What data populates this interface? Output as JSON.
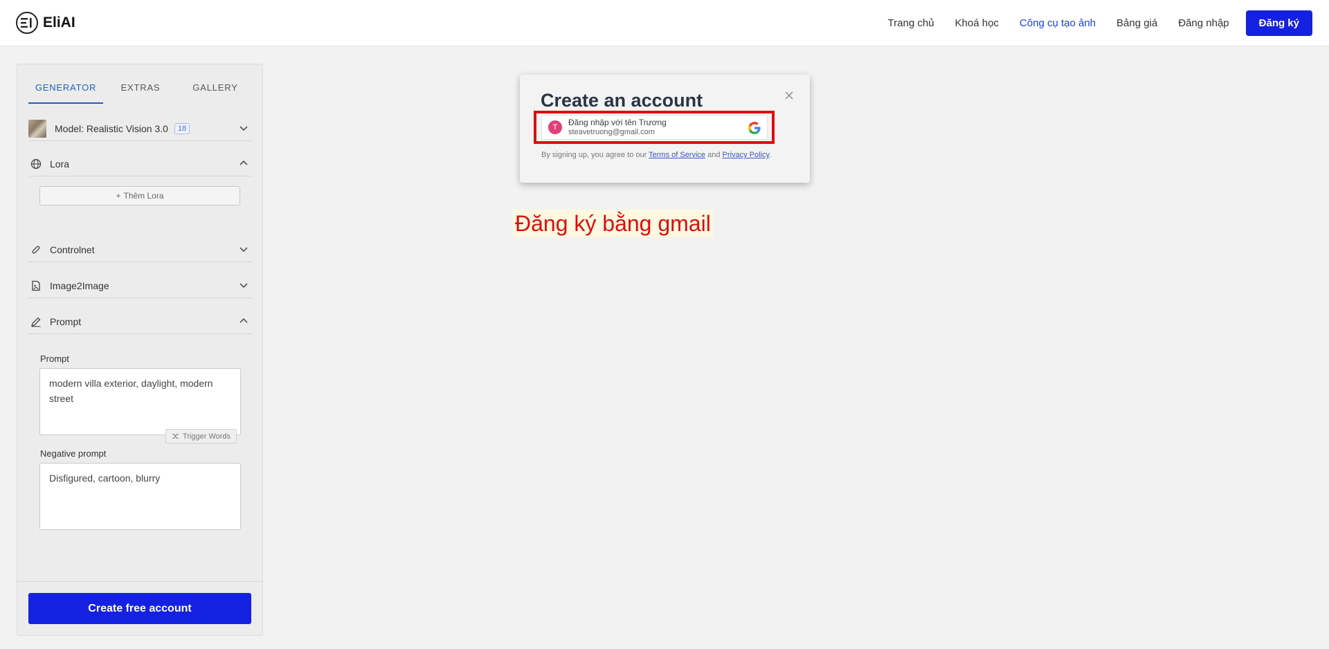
{
  "header": {
    "logo_text": "EliAI",
    "nav": [
      {
        "label": "Trang chủ"
      },
      {
        "label": "Khoá học"
      },
      {
        "label": "Công cụ tạo ảnh",
        "active": true
      },
      {
        "label": "Bảng giá"
      },
      {
        "label": "Đăng nhập"
      }
    ],
    "signup_label": "Đăng ký",
    "accent_color": "#1521e0"
  },
  "sidebar": {
    "tabs": [
      {
        "label": "GENERATOR",
        "active": true
      },
      {
        "label": "EXTRAS"
      },
      {
        "label": "GALLERY"
      }
    ],
    "model": {
      "label": "Model: Realistic Vision 3.0",
      "badge": "18"
    },
    "lora": {
      "label": "Lora",
      "add_label": "Thêm Lora"
    },
    "controlnet": {
      "label": "Controlnet"
    },
    "image2image": {
      "label": "Image2Image"
    },
    "prompt_section": {
      "label": "Prompt"
    },
    "prompt": {
      "label": "Prompt",
      "value": "modern villa exterior, daylight, modern street"
    },
    "trigger_words": "Trigger Words",
    "negative": {
      "label": "Negative prompt",
      "value": "Disfigured, cartoon, blurry"
    },
    "cta": "Create free account"
  },
  "modal": {
    "title": "Create an account",
    "google": {
      "avatar_letter": "T",
      "name_line": "Đăng nhập với tên Trương",
      "email": "steavetruong@gmail.com"
    },
    "terms": {
      "prefix": "By signing up, you agree to our ",
      "tos": "Terms of Service",
      "and": " and ",
      "privacy": "Privacy Policy",
      "suffix": "."
    },
    "highlight_color": "#e10d0d"
  },
  "annotation": "Đăng ký bằng gmail"
}
